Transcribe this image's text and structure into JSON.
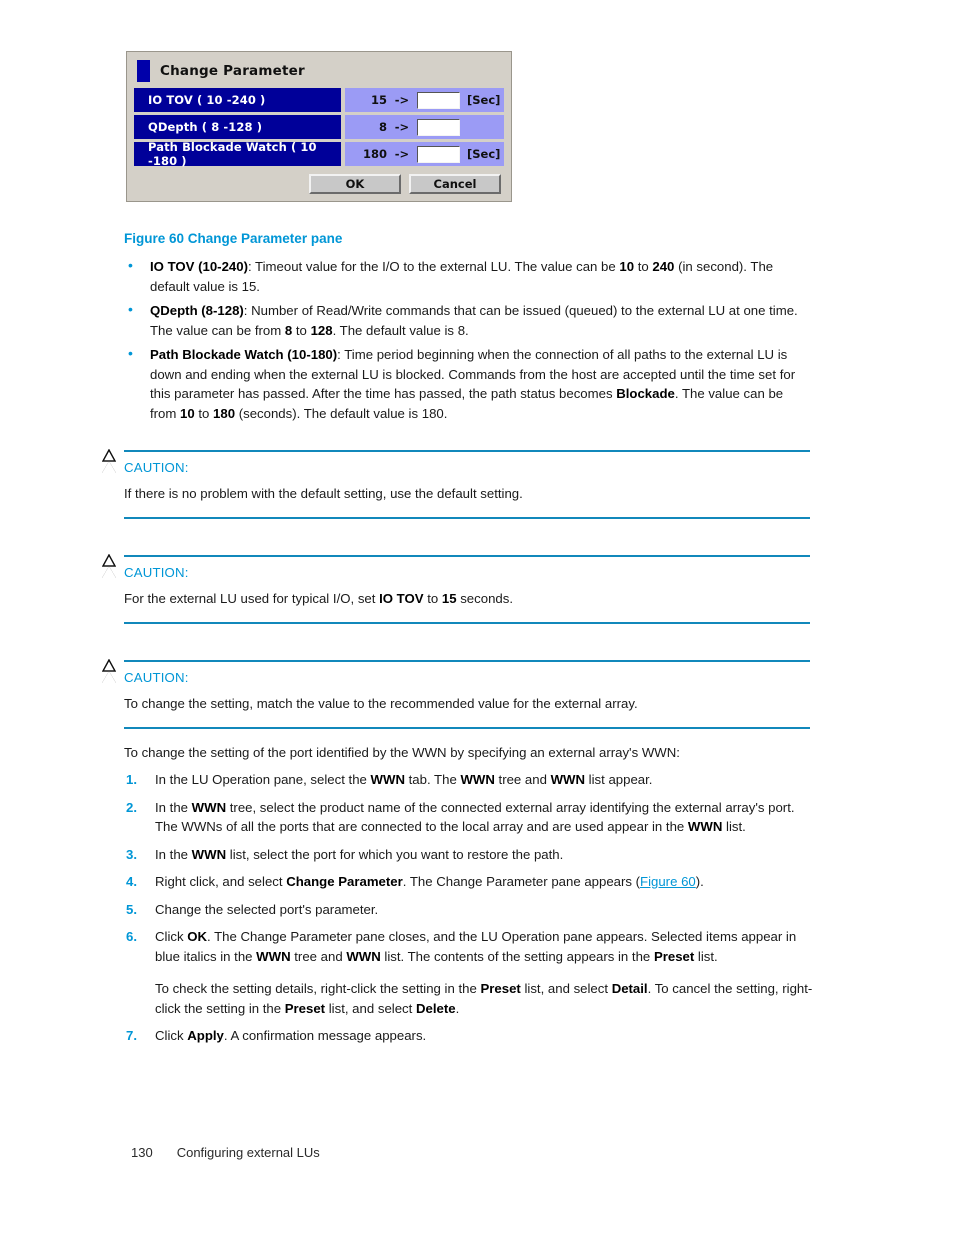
{
  "figure": {
    "caption": "Figure 60 Change Parameter pane",
    "dialog": {
      "title": "Change Parameter",
      "title_icon": "blue-square-icon",
      "rows": [
        {
          "label": "IO TOV  ( 10 -240 )",
          "current": "15",
          "arrow": "->",
          "input_value": "",
          "unit": "[Sec]"
        },
        {
          "label": "QDepth  ( 8 -128 )",
          "current": "8",
          "arrow": "->",
          "input_value": "",
          "unit": ""
        },
        {
          "label": "Path Blockade Watch  ( 10 -180 )",
          "current": "180",
          "arrow": "->",
          "input_value": "",
          "unit": "[Sec]"
        }
      ],
      "ok_label": "OK",
      "cancel_label": "Cancel"
    }
  },
  "bullets": [
    {
      "term": "IO TOV (10-240)",
      "text_1": ": Timeout value for the I/O to the external LU. The value can be ",
      "b1": "10",
      "text_2": " to ",
      "b2": "240",
      "text_3": " (in second). The default value is 15."
    },
    {
      "term": "QDepth (8-128)",
      "text_1": ": Number of Read/Write commands that can be issued (queued) to the external LU at one time. The value can be from ",
      "b1": "8",
      "text_2": " to ",
      "b2": "128",
      "text_3": ". The default value is 8."
    },
    {
      "term": "Path Blockade Watch (10-180)",
      "text_1": ": Time period beginning when the connection of all paths to the external LU is down and ending when the external LU is blocked. Commands from the host are accepted until the time set for this parameter has passed. After the time has passed, the path status becomes ",
      "b1": "Blockade",
      "text_2": ". The value can be from ",
      "b2": "10",
      "text_3": " to ",
      "b3": "180",
      "text_4": " (seconds). The default value is 180."
    }
  ],
  "cautions": [
    {
      "label": "CAUTION:",
      "icon": "warning-triangle-icon",
      "body": "If there is no problem with the default setting, use the default setting."
    },
    {
      "label": "CAUTION:",
      "icon": "warning-triangle-icon",
      "body_1": "For the external LU used for typical I/O, set ",
      "b1": "IO TOV",
      "body_2": " to ",
      "b2": "15",
      "body_3": " seconds."
    },
    {
      "label": "CAUTION:",
      "icon": "warning-triangle-icon",
      "body": "To change the setting, match the value to the recommended value for the external array."
    }
  ],
  "procedure": {
    "intro": "To change the setting of the port identified by the WWN by specifying an external array's WWN:",
    "steps": [
      {
        "num": "1.",
        "t1": "In the LU Operation pane, select the ",
        "b1": "WWN",
        "t2": " tab. The ",
        "b2": "WWN",
        "t3": " tree and ",
        "b3": "WWN",
        "t4": " list appear."
      },
      {
        "num": "2.",
        "t1": "In the ",
        "b1": "WWN",
        "t2": " tree, select the product name of the connected external array identifying the external array's port. The WWNs of all the ports that are connected to the local array and are used appear in the ",
        "b2": "WWN",
        "t3": " list."
      },
      {
        "num": "3.",
        "t1": "In the ",
        "b1": "WWN",
        "t2": " list, select the port for which you want to restore the path."
      },
      {
        "num": "4.",
        "t1": "Right click, and select ",
        "b1": "Change Parameter",
        "t2": ". The Change Parameter pane appears (",
        "link": "Figure 60",
        "t3": ")."
      },
      {
        "num": "5.",
        "t1": "Change the selected port's parameter."
      },
      {
        "num": "6.",
        "t1": "Click ",
        "b1": "OK",
        "t2": ". The Change Parameter pane closes, and the LU Operation pane appears. Selected items appear in blue italics in the ",
        "b2": "WWN",
        "t3": " tree and ",
        "b3": "WWN",
        "t4": " list. The contents of the setting appears in the ",
        "b4": "Preset",
        "t5": " list.",
        "extra_1": "To check the setting details, right-click the setting in the ",
        "xb1": "Preset",
        "extra_2": " list, and select ",
        "xb2": "Detail",
        "extra_3": ". To cancel the setting, right-click the setting in the ",
        "xb3": "Preset",
        "extra_4": " list, and select ",
        "xb4": "Delete",
        "extra_5": "."
      },
      {
        "num": "7.",
        "t1": "Click ",
        "b1": "Apply",
        "t2": ". A confirmation message appears."
      }
    ]
  },
  "footer": {
    "page_number": "130",
    "chapter": "Configuring external LUs"
  },
  "colors": {
    "accent": "#0096d6",
    "rule": "#1188bb",
    "dialog_label_bg": "#000099",
    "dialog_value_bg": "#9b9bf5",
    "dialog_bg": "#d4d0c8"
  }
}
